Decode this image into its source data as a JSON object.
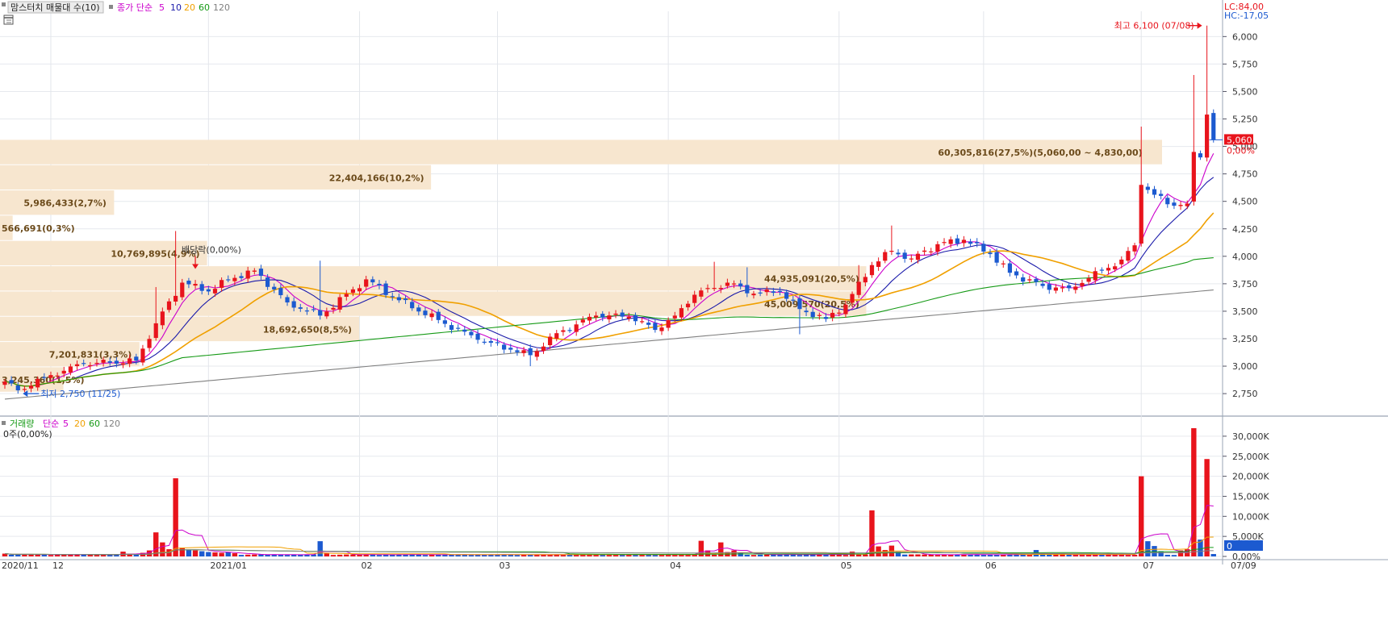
{
  "price_panel": {
    "legend": {
      "name": "맘스터치 매물대 수(10)",
      "ma_label": "종가 단순",
      "ma_periods": [
        "5",
        "10",
        "20",
        "60",
        "120"
      ],
      "ma_colors": [
        "#cc00cc",
        "#1a1aaa",
        "#f0a000",
        "#169a16",
        "#808080"
      ]
    },
    "corner": {
      "lc": "LC:84,00",
      "hc": "HC:-17,05"
    },
    "current_price_label": "5,060",
    "current_change_label": "0,00%",
    "high_annotation": "최고 6,100 (07/08)",
    "low_annotation": "최저 2,750 (11/25)",
    "dividend_label": "배당락(0,00%)"
  },
  "volume_panel": {
    "legend": {
      "name": "거래량",
      "ma_label": "단순",
      "ma_periods": [
        "5",
        "20",
        "60",
        "120"
      ]
    },
    "info": "0주(0,00%)",
    "current_label": "0",
    "current_change_label": "0,00%"
  },
  "colors": {
    "up": "#e8141c",
    "down": "#1c5ad0",
    "profile": "#f7e6cf",
    "profile_text": "#6b4a1a"
  },
  "chart_data": [
    {
      "type": "candlestick",
      "title": "",
      "price_axis": {
        "ticks": [
          "2,750",
          "3,000",
          "3,250",
          "3,500",
          "3,750",
          "4,000",
          "4,250",
          "4,500",
          "4,750",
          "5,000",
          "5,250",
          "5,500",
          "5,750",
          "6,000"
        ],
        "ylim": [
          2560,
          6230
        ]
      },
      "time_axis": {
        "labels": [
          "2020/11",
          "12",
          "2021/01",
          "02",
          "03",
          "04",
          "05",
          "06",
          "07",
          "07/09"
        ]
      },
      "anchors": [
        {
          "i": 0,
          "c": 2860
        },
        {
          "i": 2,
          "c": 2780
        },
        {
          "i": 6,
          "c": 2900
        },
        {
          "i": 12,
          "c": 3020
        },
        {
          "i": 20,
          "c": 3050
        },
        {
          "i": 23,
          "c": 3390
        },
        {
          "i": 27,
          "c": 3760
        },
        {
          "i": 31,
          "c": 3680
        },
        {
          "i": 34,
          "c": 3790
        },
        {
          "i": 38,
          "c": 3870
        },
        {
          "i": 43,
          "c": 3580
        },
        {
          "i": 48,
          "c": 3460
        },
        {
          "i": 55,
          "c": 3790
        },
        {
          "i": 60,
          "c": 3600
        },
        {
          "i": 66,
          "c": 3420
        },
        {
          "i": 72,
          "c": 3240
        },
        {
          "i": 77,
          "c": 3150
        },
        {
          "i": 80,
          "c": 3100
        },
        {
          "i": 84,
          "c": 3300
        },
        {
          "i": 90,
          "c": 3460
        },
        {
          "i": 95,
          "c": 3450
        },
        {
          "i": 99,
          "c": 3330
        },
        {
          "i": 102,
          "c": 3460
        },
        {
          "i": 105,
          "c": 3650
        },
        {
          "i": 110,
          "c": 3760
        },
        {
          "i": 114,
          "c": 3660
        },
        {
          "i": 118,
          "c": 3680
        },
        {
          "i": 121,
          "c": 3520
        },
        {
          "i": 125,
          "c": 3430
        },
        {
          "i": 128,
          "c": 3560
        },
        {
          "i": 132,
          "c": 3920
        },
        {
          "i": 135,
          "c": 4050
        },
        {
          "i": 138,
          "c": 3980
        },
        {
          "i": 142,
          "c": 4110
        },
        {
          "i": 146,
          "c": 4150
        },
        {
          "i": 150,
          "c": 4020
        },
        {
          "i": 153,
          "c": 3850
        },
        {
          "i": 158,
          "c": 3730
        },
        {
          "i": 162,
          "c": 3710
        },
        {
          "i": 165,
          "c": 3800
        },
        {
          "i": 170,
          "c": 3970
        },
        {
          "i": 172,
          "c": 4100
        },
        {
          "i": 173,
          "c": 4650
        },
        {
          "i": 175,
          "c": 4560
        },
        {
          "i": 178,
          "c": 4460
        },
        {
          "i": 180,
          "c": 4480
        },
        {
          "i": 181,
          "c": 4950
        },
        {
          "i": 182,
          "c": 4900
        },
        {
          "i": 183,
          "c": 5290
        },
        {
          "i": 184,
          "c": 5060
        }
      ],
      "special_candles": [
        {
          "i": 23,
          "h": 3720
        },
        {
          "i": 26,
          "h": 4230
        },
        {
          "i": 48,
          "h": 3960
        },
        {
          "i": 108,
          "h": 3950
        },
        {
          "i": 113,
          "h": 3900
        },
        {
          "i": 130,
          "h": 3920
        },
        {
          "i": 135,
          "h": 4280
        },
        {
          "i": 173,
          "h": 5180
        },
        {
          "i": 181,
          "h": 5650
        },
        {
          "i": 183,
          "h": 6100
        },
        {
          "i": 2,
          "l": 2750
        },
        {
          "i": 80,
          "l": 3000
        },
        {
          "i": 121,
          "l": 3290
        }
      ],
      "volume_profile": [
        {
          "label": "60,305,816(27,5%)(5,060,00 ~ 4,830,00)",
          "lo": 4830,
          "hi": 5060,
          "pct": 27.5
        },
        {
          "label": "22,404,166(10,2%)",
          "lo": 4600,
          "hi": 4830,
          "pct": 10.2
        },
        {
          "label": "5,986,433(2,7%)",
          "lo": 4370,
          "hi": 4600,
          "pct": 2.7
        },
        {
          "label": "566,691(0,3%)",
          "lo": 4140,
          "hi": 4370,
          "pct": 0.3
        },
        {
          "label": "10,769,895(4,9%)",
          "lo": 3910,
          "hi": 4140,
          "pct": 4.9
        },
        {
          "label": "44,935,091(20,5%)",
          "lo": 3680,
          "hi": 3910,
          "pct": 20.5
        },
        {
          "label": "45,009,570(20,5%)",
          "lo": 3450,
          "hi": 3680,
          "pct": 20.5
        },
        {
          "label": "18,692,650(8,5%)",
          "lo": 3220,
          "hi": 3450,
          "pct": 8.5
        },
        {
          "label": "7,201,831(3,3%)",
          "lo": 2990,
          "hi": 3220,
          "pct": 3.3
        },
        {
          "label": "3,245,360(1,5%)",
          "lo": 2760,
          "hi": 2990,
          "pct": 1.5
        }
      ]
    },
    {
      "type": "bar",
      "title": "",
      "volume_axis": {
        "ticks": [
          "0,00%",
          "5,000K",
          "10,000K",
          "15,000K",
          "20,000K",
          "25,000K",
          "30,000K"
        ],
        "ylim": [
          0,
          33000
        ]
      },
      "base_volume": 350,
      "spikes": [
        {
          "i": 0,
          "v": 700
        },
        {
          "i": 6,
          "v": 600
        },
        {
          "i": 18,
          "v": 1200
        },
        {
          "i": 21,
          "v": 900
        },
        {
          "i": 22,
          "v": 1500
        },
        {
          "i": 23,
          "v": 6000
        },
        {
          "i": 24,
          "v": 3500
        },
        {
          "i": 25,
          "v": 1800
        },
        {
          "i": 26,
          "v": 19500
        },
        {
          "i": 27,
          "v": 2200
        },
        {
          "i": 28,
          "v": 1600
        },
        {
          "i": 29,
          "v": 1500
        },
        {
          "i": 30,
          "v": 1300
        },
        {
          "i": 31,
          "v": 1100
        },
        {
          "i": 32,
          "v": 1000
        },
        {
          "i": 33,
          "v": 900
        },
        {
          "i": 34,
          "v": 1100
        },
        {
          "i": 35,
          "v": 800
        },
        {
          "i": 48,
          "v": 3800
        },
        {
          "i": 49,
          "v": 900
        },
        {
          "i": 106,
          "v": 3900
        },
        {
          "i": 107,
          "v": 1500
        },
        {
          "i": 109,
          "v": 3500
        },
        {
          "i": 110,
          "v": 1100
        },
        {
          "i": 111,
          "v": 1500
        },
        {
          "i": 112,
          "v": 1000
        },
        {
          "i": 129,
          "v": 1200
        },
        {
          "i": 132,
          "v": 11500
        },
        {
          "i": 133,
          "v": 2500
        },
        {
          "i": 134,
          "v": 1600
        },
        {
          "i": 135,
          "v": 2700
        },
        {
          "i": 136,
          "v": 1200
        },
        {
          "i": 157,
          "v": 1600
        },
        {
          "i": 173,
          "v": 20000
        },
        {
          "i": 174,
          "v": 3800
        },
        {
          "i": 175,
          "v": 2600
        },
        {
          "i": 176,
          "v": 1300
        },
        {
          "i": 179,
          "v": 1500
        },
        {
          "i": 180,
          "v": 1800
        },
        {
          "i": 181,
          "v": 32000
        },
        {
          "i": 182,
          "v": 4200
        },
        {
          "i": 183,
          "v": 24300
        },
        {
          "i": 184,
          "v": 600
        }
      ]
    }
  ]
}
